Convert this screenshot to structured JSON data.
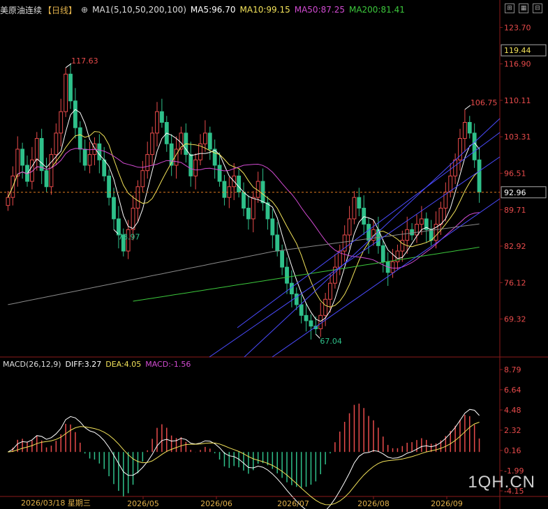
{
  "header": {
    "symbol": "美原油连续",
    "period": "【日线】",
    "ma_title": "MA1(5,10,50,200,100)",
    "ma5": "MA5:96.70",
    "ma10": "MA10:99.15",
    "ma50": "MA50:87.25",
    "ma200": "MA200:81.41"
  },
  "macd_header": {
    "title": "MACD(26,12,9)",
    "diff": "DIFF:3.27",
    "dea": "DEA:4.05",
    "macd": "MACD:-1.56"
  },
  "colors": {
    "up": "#e84b4b",
    "down": "#2fc08a",
    "ma5": "#ffffff",
    "ma10": "#f3e35a",
    "ma50": "#d24bd2",
    "ma200": "#3cc83c",
    "ma100": "#8a8a8a",
    "channel": "#4b4bff",
    "dash": "#e07a1f"
  },
  "bottom": {
    "date": "2026/03/18 星期三"
  },
  "watermark": "1QH.CN",
  "chart_data": {
    "type": "candlestick",
    "price_axis": {
      "ticks": [
        "123.70",
        "116.90",
        "110.11",
        "103.31",
        "96.51",
        "89.71",
        "82.92",
        "76.12",
        "69.32"
      ],
      "ylim": [
        62.5,
        127
      ],
      "current_price": "92.96",
      "top_marker": "119.44"
    },
    "annotations": [
      {
        "label": "117.63",
        "type": "high"
      },
      {
        "label": "78.97",
        "type": "low"
      },
      {
        "label": "67.04",
        "type": "low"
      },
      {
        "label": "106.75",
        "type": "high"
      }
    ],
    "x_ticks": [
      "2026/05",
      "2026/06",
      "2026/07",
      "2026/08",
      "2026/09"
    ],
    "macd_axis": {
      "ticks": [
        "8.79",
        "6.64",
        "4.48",
        "2.32",
        "0.16",
        "-1.99",
        "-4.15"
      ]
    },
    "close": [
      92,
      96,
      101,
      98,
      95,
      99,
      103,
      97,
      94,
      100,
      104,
      108,
      115,
      110,
      105,
      101,
      98,
      100,
      102,
      99,
      96,
      92,
      88,
      85,
      82,
      86,
      90,
      94,
      97,
      100,
      104,
      108,
      106,
      102,
      98,
      101,
      104,
      100,
      96,
      99,
      102,
      104,
      101,
      98,
      95,
      92,
      94,
      96,
      93,
      90,
      88,
      92,
      95,
      91,
      88,
      85,
      82,
      79,
      76,
      74,
      72,
      70,
      69,
      68,
      67.5,
      70,
      73,
      76,
      79,
      82,
      85,
      88,
      92,
      90,
      87,
      84,
      86,
      83,
      80,
      78,
      80,
      82,
      84,
      86,
      85,
      87,
      88,
      86,
      84,
      87,
      90,
      93,
      96,
      99,
      103,
      106,
      104,
      99,
      93
    ]
  }
}
